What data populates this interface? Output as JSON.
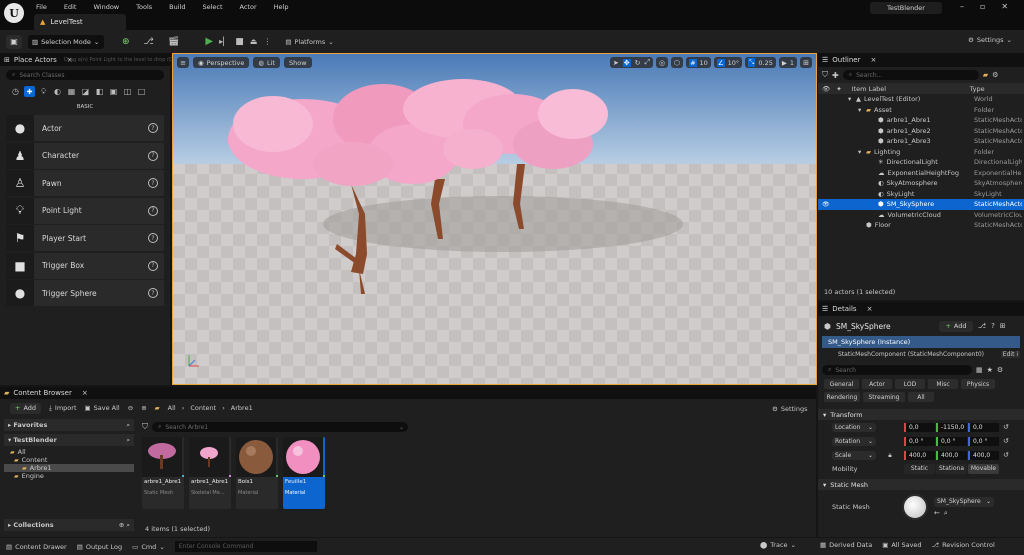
{
  "menu": {
    "items": [
      "File",
      "Edit",
      "Window",
      "Tools",
      "Build",
      "Select",
      "Actor",
      "Help"
    ],
    "project": "TestBlender"
  },
  "level_tab": "LevelTest",
  "toolbar": {
    "mode": "Selection Mode",
    "platforms": "Platforms",
    "settings": "Settings"
  },
  "place_actors": {
    "title": "Place Actors",
    "tooltip": "Drag a(n) Point Light to the level to drop (Ctrl+G)",
    "search_placeholder": "Search Classes",
    "category": "BASIC",
    "items": [
      "Actor",
      "Character",
      "Pawn",
      "Point Light",
      "Player Start",
      "Trigger Box",
      "Trigger Sphere"
    ]
  },
  "viewport": {
    "perspective": "Perspective",
    "lit": "Lit",
    "show": "Show",
    "grid": "10",
    "angle": "10°",
    "scale": "0.25",
    "cams": "1"
  },
  "outliner": {
    "title": "Outliner",
    "search_placeholder": "Search...",
    "col_label": "Item Label",
    "col_type": "Type",
    "rows": [
      {
        "label": "LevelTest (Editor)",
        "type": "World",
        "indent": 30,
        "kind": "world"
      },
      {
        "label": "Asset",
        "type": "Folder",
        "indent": 40,
        "kind": "folder"
      },
      {
        "label": "arbre1_Abre1",
        "type": "StaticMeshActor",
        "indent": 52,
        "kind": "mesh"
      },
      {
        "label": "arbre1_Abre2",
        "type": "StaticMeshActor",
        "indent": 52,
        "kind": "mesh"
      },
      {
        "label": "arbre1_Abre3",
        "type": "StaticMeshActor",
        "indent": 52,
        "kind": "mesh"
      },
      {
        "label": "Lighting",
        "type": "Folder",
        "indent": 40,
        "kind": "folder"
      },
      {
        "label": "DirectionalLight",
        "type": "DirectionalLight",
        "indent": 52,
        "kind": "light"
      },
      {
        "label": "ExponentialHeightFog",
        "type": "ExponentialHeightFog",
        "indent": 52,
        "kind": "fog"
      },
      {
        "label": "SkyAtmosphere",
        "type": "SkyAtmosphere",
        "indent": 52,
        "kind": "sky"
      },
      {
        "label": "SkyLight",
        "type": "SkyLight",
        "indent": 52,
        "kind": "sky"
      },
      {
        "label": "SM_SkySphere",
        "type": "StaticMeshActor",
        "indent": 52,
        "kind": "mesh"
      },
      {
        "label": "VolumetricCloud",
        "type": "VolumetricCloud",
        "indent": 52,
        "kind": "cloud"
      },
      {
        "label": "Floor",
        "type": "StaticMeshActor",
        "indent": 40,
        "kind": "mesh"
      }
    ],
    "status": "10 actors (1 selected)"
  },
  "details": {
    "title": "Details",
    "actor": "SM_SkySphere",
    "add": "Add",
    "instance": "SM_SkySphere (Instance)",
    "component": "StaticMeshComponent (StaticMeshComponent0)",
    "component_edit": "Edit i",
    "search_placeholder": "Search",
    "tabs_row1": [
      "General",
      "Actor",
      "LOD",
      "Misc",
      "Physics"
    ],
    "tabs_row2": [
      "Rendering",
      "Streaming",
      "All"
    ],
    "transform_title": "Transform",
    "location_label": "Location",
    "location": [
      "0,0",
      "-1150,0",
      "0,0"
    ],
    "rotation_label": "Rotation",
    "rotation": [
      "0,0 °",
      "0,0 °",
      "0,0 °"
    ],
    "scale_label": "Scale",
    "scale": [
      "400,0",
      "400,0",
      "400,0"
    ],
    "mobility_label": "Mobility",
    "mobility": [
      "Static",
      "Stationa",
      "Movable"
    ],
    "static_mesh_title": "Static Mesh",
    "static_mesh_label": "Static Mesh",
    "static_mesh_value": "SM_SkySphere"
  },
  "content_browser": {
    "title": "Content Browser",
    "add": "Add",
    "import": "Import",
    "save_all": "Save All",
    "settings": "Settings",
    "path": [
      "All",
      "Content",
      "Arbre1"
    ],
    "search_placeholder": "Search Arbre1",
    "favorites": "Favorites",
    "project": "TestBlender",
    "tree": [
      "All",
      "Content",
      "Arbre1",
      "Engine"
    ],
    "collections": "Collections",
    "assets": [
      {
        "name": "arbre1_Abre1",
        "type": "Static Mesh",
        "kind": "tree"
      },
      {
        "name": "arbre1_Abre1",
        "type": "Skeletal Me...",
        "kind": "branch"
      },
      {
        "name": "Bois1",
        "type": "Material",
        "kind": "wood"
      },
      {
        "name": "Feuille1",
        "type": "Material",
        "kind": "pink"
      }
    ],
    "count": "4 items (1 selected)"
  },
  "statusbar": {
    "content_drawer": "Content Drawer",
    "output_log": "Output Log",
    "cmd": "Cmd",
    "console_placeholder": "Enter Console Command",
    "trace": "Trace",
    "derived": "Derived Data",
    "saved": "All Saved",
    "revision": "Revision Control"
  },
  "colors": {
    "accent": "#0d66d0",
    "selection": "#0d66d0",
    "play_green": "#4caf50"
  }
}
